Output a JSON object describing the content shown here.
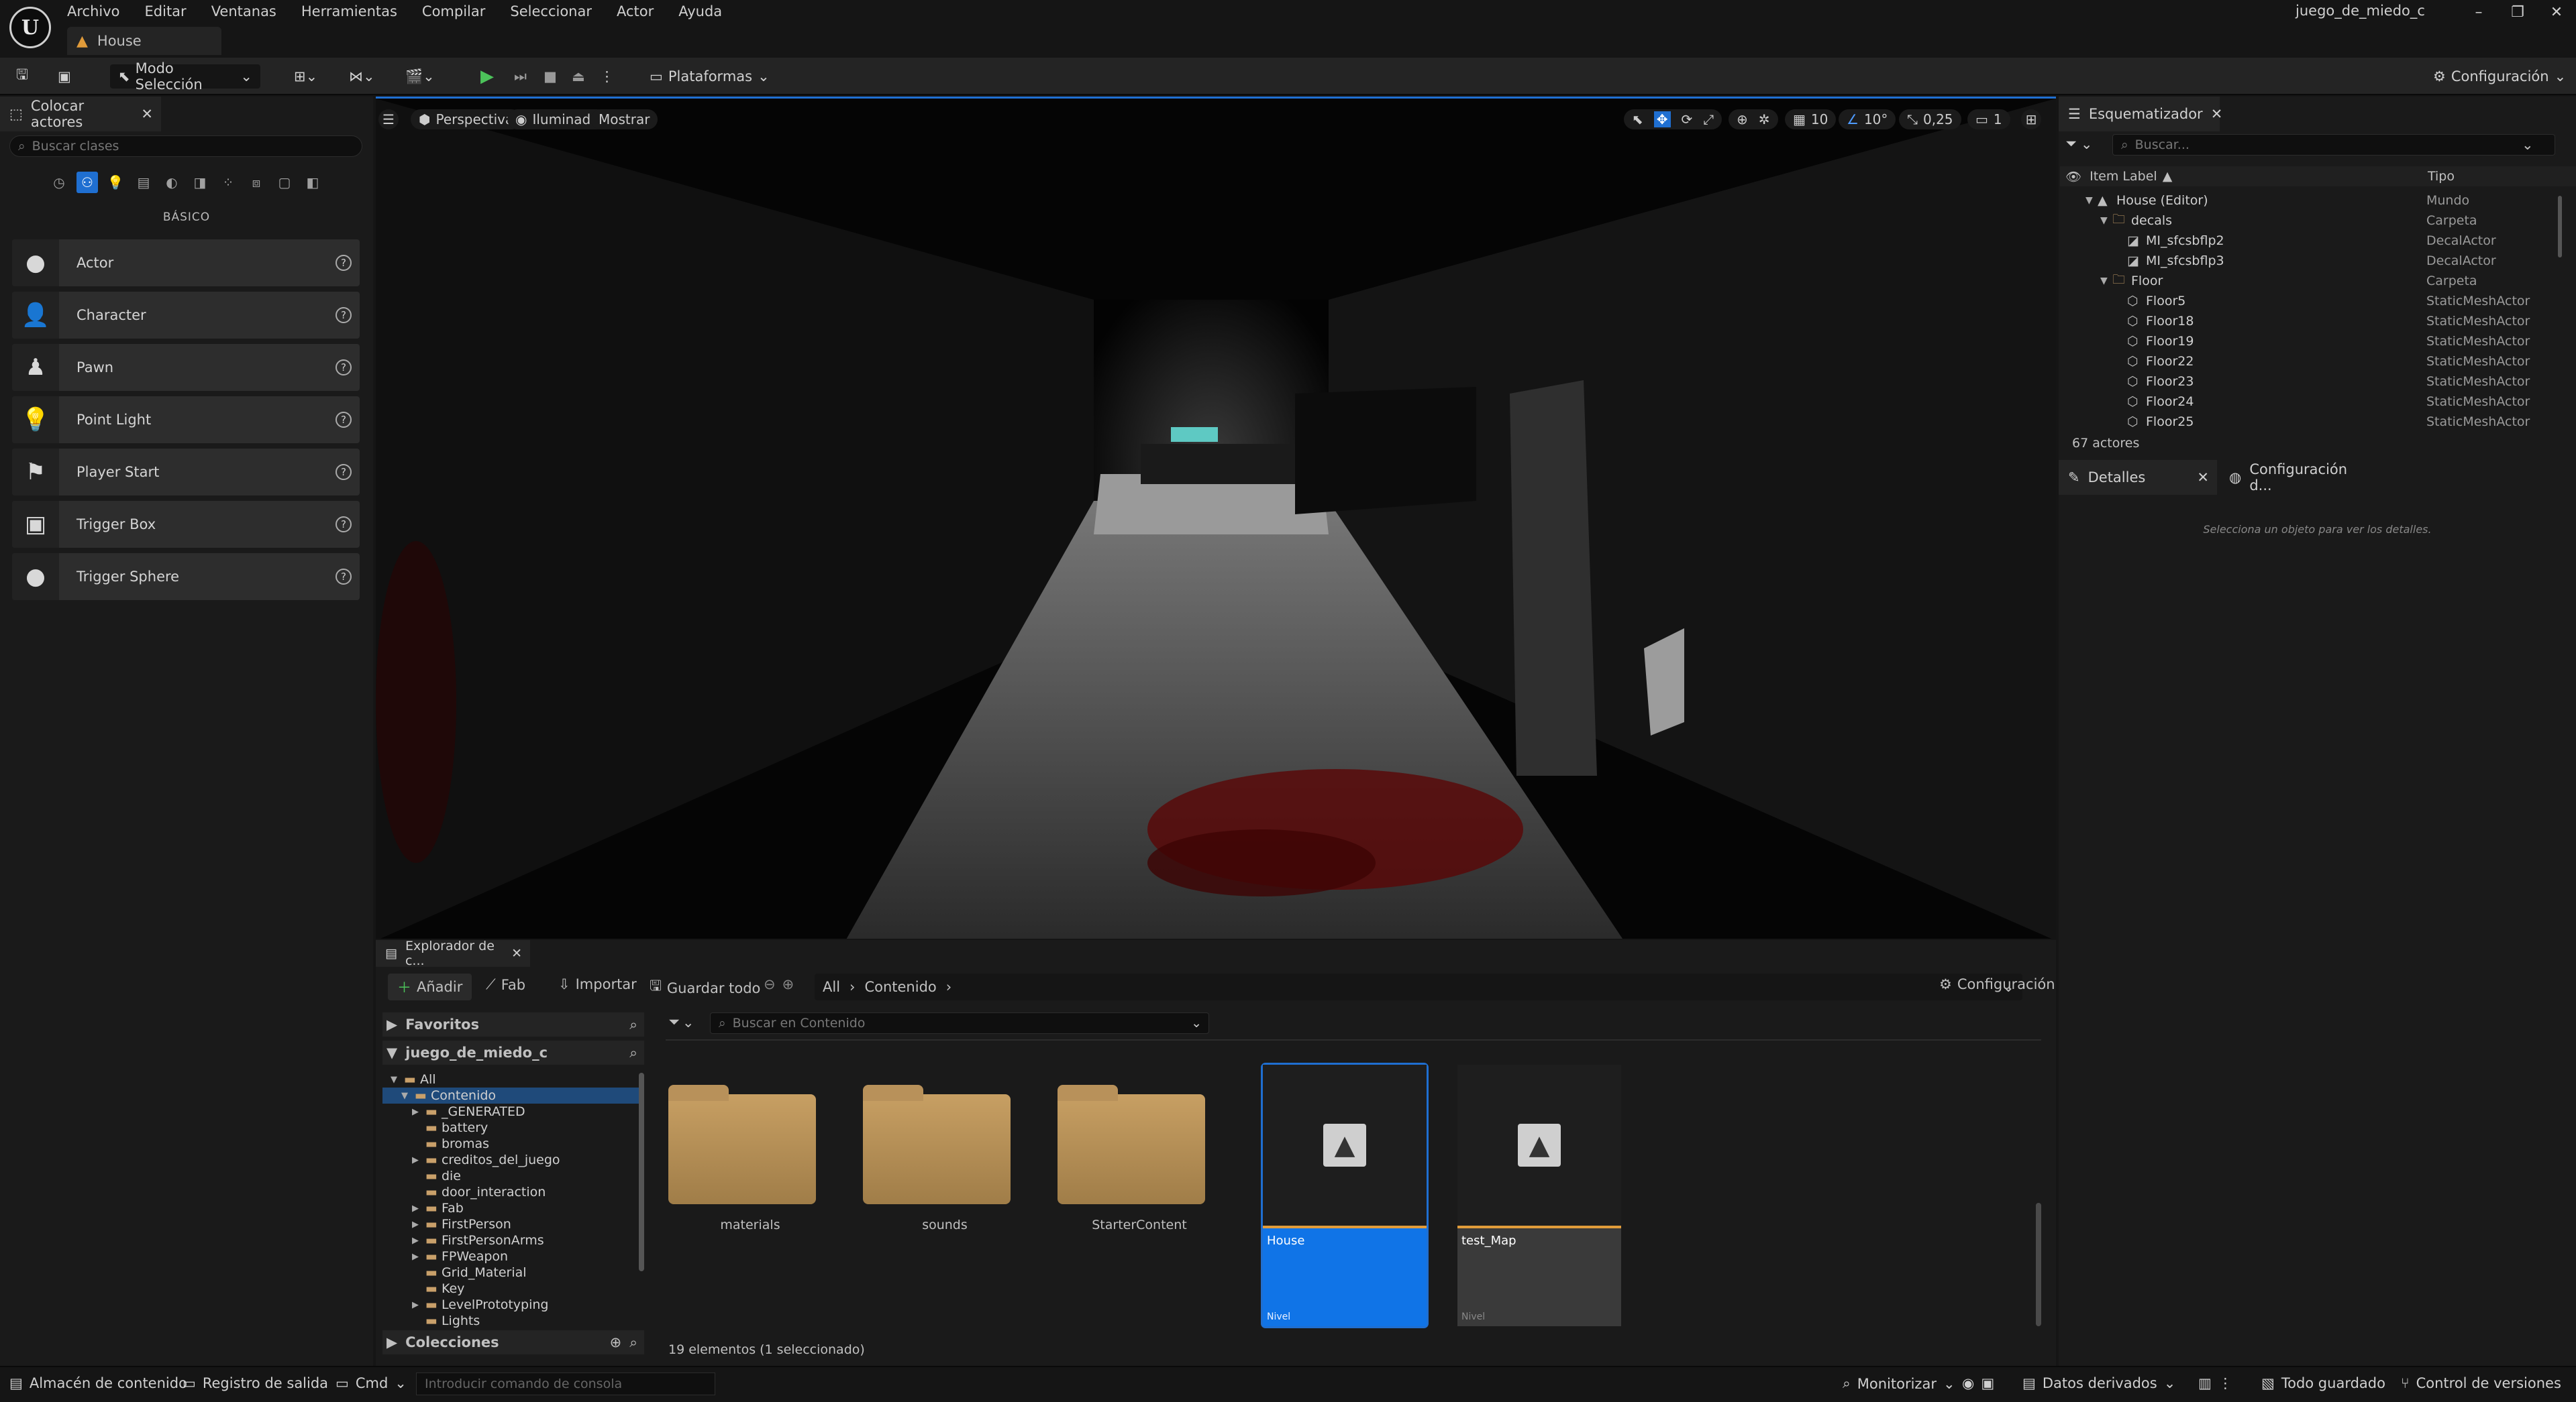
{
  "app": {
    "menu": [
      "Archivo",
      "Editar",
      "Ventanas",
      "Herramientas",
      "Compilar",
      "Seleccionar",
      "Actor",
      "Ayuda"
    ],
    "map_tab": "House",
    "project_name": "juego_de_miedo_c"
  },
  "toolbar": {
    "mode": "Modo Selección",
    "platforms": "Plataformas",
    "settings": "Configuración"
  },
  "place_actors": {
    "tab": "Colocar actores",
    "search_placeholder": "Buscar clases",
    "category": "BÁSICO",
    "items": [
      {
        "label": "Actor",
        "icon": "sphere-icon"
      },
      {
        "label": "Character",
        "icon": "person-icon"
      },
      {
        "label": "Pawn",
        "icon": "pawn-icon"
      },
      {
        "label": "Point Light",
        "icon": "bulb-icon"
      },
      {
        "label": "Player Start",
        "icon": "flag-icon"
      },
      {
        "label": "Trigger Box",
        "icon": "box-icon"
      },
      {
        "label": "Trigger Sphere",
        "icon": "sphere-icon"
      }
    ]
  },
  "viewport": {
    "perspective": "Perspectiva",
    "lit": "Iluminado",
    "show": "Mostrar",
    "grid_snap": "10",
    "rot_snap": "10°",
    "scale_snap": "0,25",
    "camera_speed": "1"
  },
  "outliner": {
    "tab": "Esquematizador",
    "search_placeholder": "Buscar...",
    "col_label": "Item Label",
    "col_type": "Tipo",
    "rows": [
      {
        "label": "House (Editor)",
        "type": "Mundo",
        "indent": 0,
        "kind": "world"
      },
      {
        "label": "decals",
        "type": "Carpeta",
        "indent": 1,
        "kind": "folder"
      },
      {
        "label": "MI_sfcsbflp2",
        "type": "DecalActor",
        "indent": 2,
        "kind": "decal"
      },
      {
        "label": "MI_sfcsbflp3",
        "type": "DecalActor",
        "indent": 2,
        "kind": "decal"
      },
      {
        "label": "Floor",
        "type": "Carpeta",
        "indent": 1,
        "kind": "folder"
      },
      {
        "label": "Floor5",
        "type": "StaticMeshActor",
        "indent": 2,
        "kind": "mesh"
      },
      {
        "label": "Floor18",
        "type": "StaticMeshActor",
        "indent": 2,
        "kind": "mesh"
      },
      {
        "label": "Floor19",
        "type": "StaticMeshActor",
        "indent": 2,
        "kind": "mesh"
      },
      {
        "label": "Floor22",
        "type": "StaticMeshActor",
        "indent": 2,
        "kind": "mesh"
      },
      {
        "label": "Floor23",
        "type": "StaticMeshActor",
        "indent": 2,
        "kind": "mesh"
      },
      {
        "label": "Floor24",
        "type": "StaticMeshActor",
        "indent": 2,
        "kind": "mesh"
      },
      {
        "label": "Floor25",
        "type": "StaticMeshActor",
        "indent": 2,
        "kind": "mesh"
      }
    ],
    "count": "67 actores"
  },
  "details": {
    "tab": "Detalles",
    "tab2": "Configuración d...",
    "empty": "Selecciona un objeto para ver los detalles."
  },
  "content_browser": {
    "tab": "Explorador de c...",
    "add": "Añadir",
    "fab": "Fab",
    "import": "Importar",
    "save_all": "Guardar todo",
    "path_all": "All",
    "path_content": "Contenido",
    "settings": "Configuración",
    "favorites": "Favoritos",
    "project": "juego_de_miedo_c",
    "collections": "Colecciones",
    "search_placeholder": "Buscar en Contenido",
    "tree": [
      {
        "label": "All",
        "indent": 0,
        "arrow": "▼"
      },
      {
        "label": "Contenido",
        "indent": 1,
        "arrow": "▼",
        "selected": true
      },
      {
        "label": "_GENERATED",
        "indent": 2,
        "arrow": "▶"
      },
      {
        "label": "battery",
        "indent": 2,
        "arrow": ""
      },
      {
        "label": "bromas",
        "indent": 2,
        "arrow": ""
      },
      {
        "label": "creditos_del_juego",
        "indent": 2,
        "arrow": "▶"
      },
      {
        "label": "die",
        "indent": 2,
        "arrow": ""
      },
      {
        "label": "door_interaction",
        "indent": 2,
        "arrow": ""
      },
      {
        "label": "Fab",
        "indent": 2,
        "arrow": "▶"
      },
      {
        "label": "FirstPerson",
        "indent": 2,
        "arrow": "▶"
      },
      {
        "label": "FirstPersonArms",
        "indent": 2,
        "arrow": "▶"
      },
      {
        "label": "FPWeapon",
        "indent": 2,
        "arrow": "▶"
      },
      {
        "label": "Grid_Material",
        "indent": 2,
        "arrow": ""
      },
      {
        "label": "Key",
        "indent": 2,
        "arrow": ""
      },
      {
        "label": "LevelPrototyping",
        "indent": 2,
        "arrow": "▶"
      },
      {
        "label": "Lights",
        "indent": 2,
        "arrow": ""
      }
    ],
    "folders": [
      "materials",
      "sounds",
      "StarterContent"
    ],
    "assets": [
      {
        "name": "House",
        "kind": "Nivel",
        "selected": true
      },
      {
        "name": "test_Map",
        "kind": "Nivel",
        "selected": false
      }
    ],
    "status": "19 elementos (1 seleccionado)"
  },
  "statusbar": {
    "content_drawer": "Almacén de contenido",
    "output_log": "Registro de salida",
    "cmd": "Cmd",
    "cmd_placeholder": "Introducir comando de consola",
    "monitor": "Monitorizar",
    "derived_data": "Datos derivados",
    "all_saved": "Todo guardado",
    "source_control": "Control de versiones"
  },
  "colors": {
    "accent": "#1f6fd1",
    "folder": "#c9a06a",
    "play": "#4cc35a",
    "level_bar": "#e09b3a"
  }
}
